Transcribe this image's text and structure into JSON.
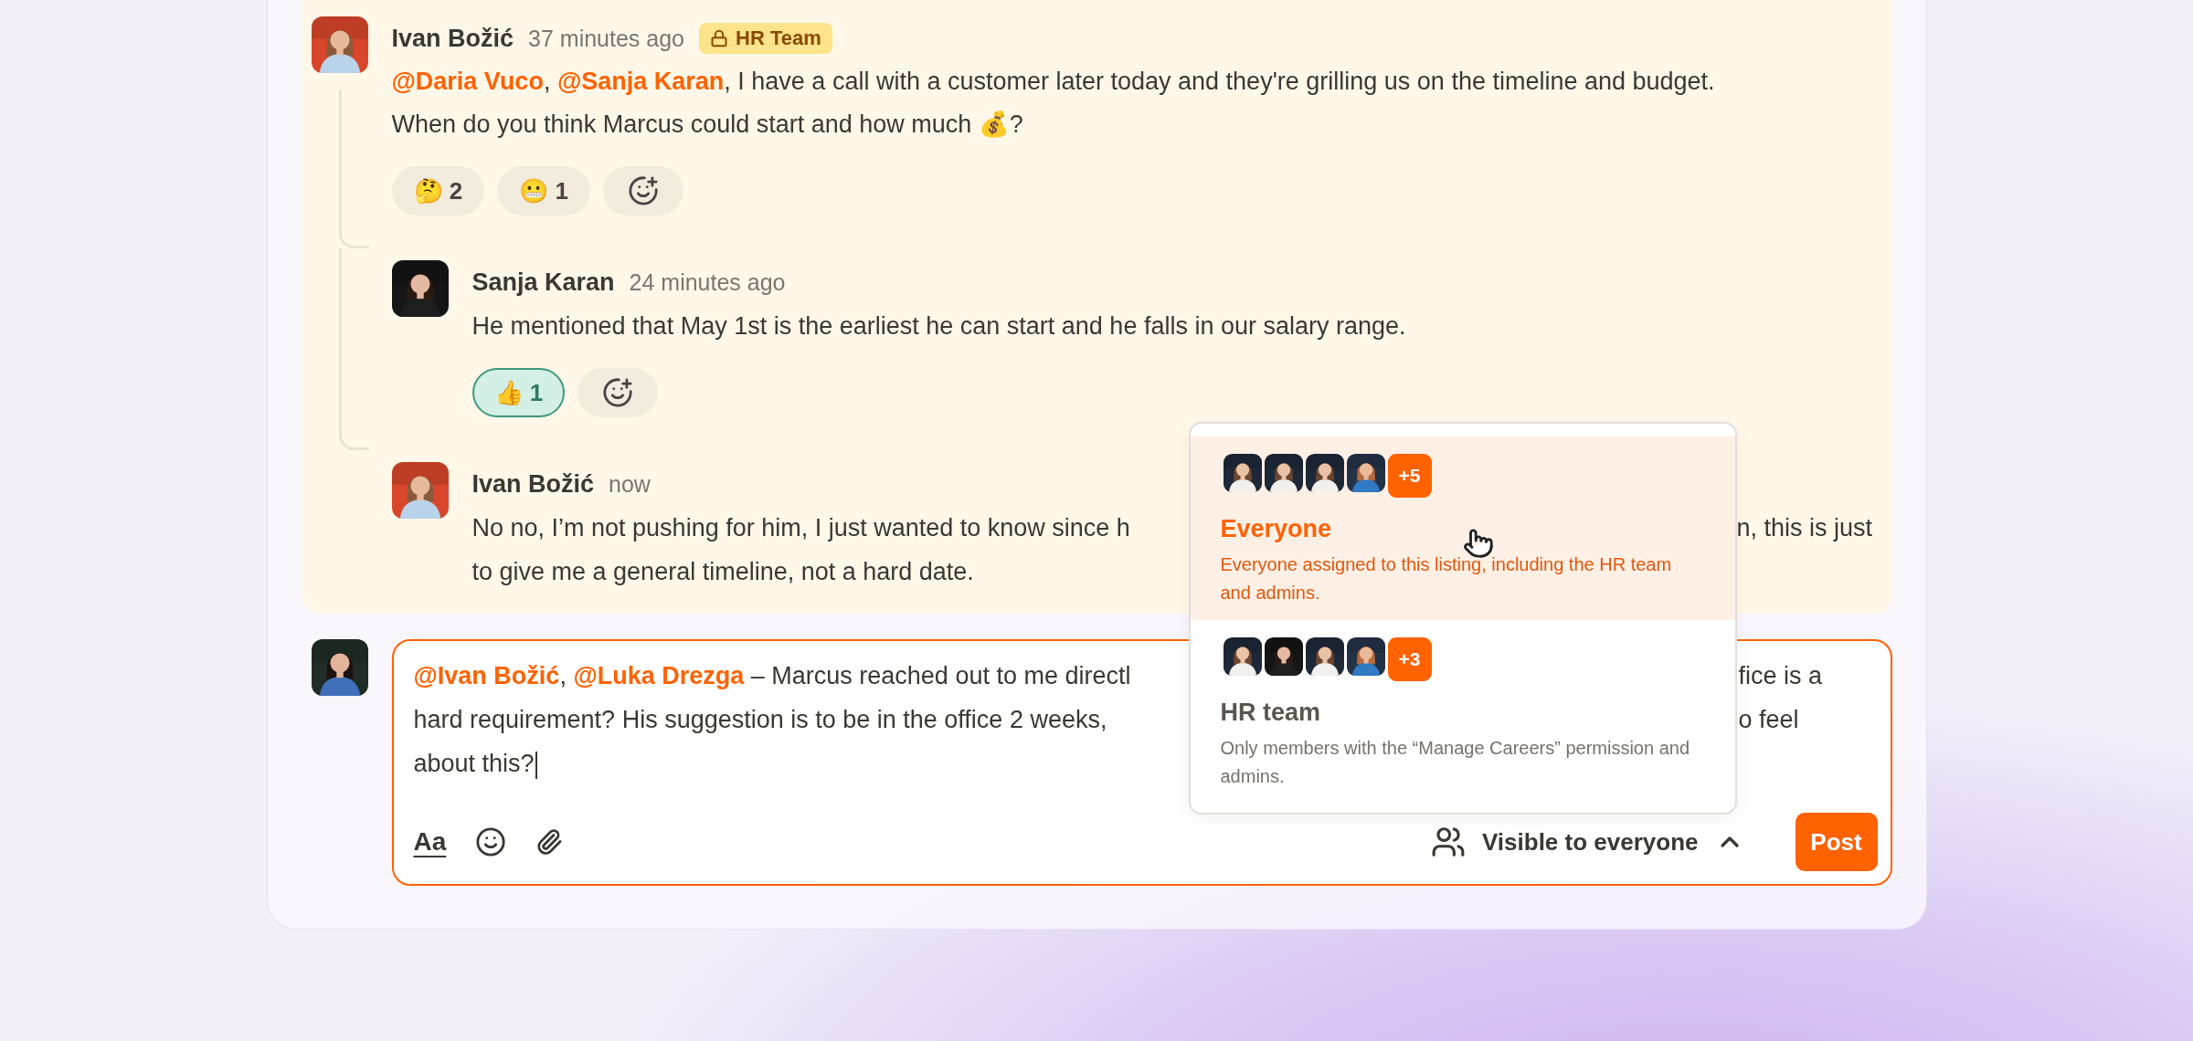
{
  "thread": {
    "root": {
      "author": "Ivan Božić",
      "time": "37 minutes ago",
      "badge": {
        "label": "HR Team"
      },
      "text": "**@Daria Vuco**, **@Sanja Karan**, I have a call with a customer later today and they're grilling us on the timeline and budget. When do you think Marcus could start and how much 💰?",
      "reactions": [
        {
          "emoji": "🤔",
          "count": "2",
          "selected": false
        },
        {
          "emoji": "😬",
          "count": "1",
          "selected": false
        }
      ]
    },
    "replies": [
      {
        "author": "Sanja Karan",
        "time": "24 minutes ago",
        "lines": [
          {
            "left": "He mentioned that May 1st is the earliest he can start and he falls in our salary range."
          }
        ],
        "reactions": [
          {
            "emoji": "👍",
            "count": "1",
            "selected": true
          }
        ]
      },
      {
        "author": "Ivan Božić",
        "time": "now",
        "lines": [
          {
            "left": "No no, I’m not pushing for him, I just wanted to know since h",
            "right": "n, this is just"
          },
          {
            "left": "to give me a general timeline, not a hard date."
          }
        ]
      }
    ]
  },
  "composer": {
    "lines": [
      {
        "left": "**@Ivan Božić**, **@Luka Drezga** – Marcus reached out to me directl",
        "right": "fice is a"
      },
      {
        "left": "hard requirement? His suggestion is to be in the office 2 weeks,",
        "right": "o feel"
      },
      {
        "left": "about this?"
      }
    ],
    "format_button": "Aa",
    "visibility": "Visible to everyone",
    "post_button": "Post"
  },
  "visibility_menu": {
    "options": [
      {
        "title": "Everyone",
        "description": "Everyone assigned to this listing, including the HR team and admins.",
        "more": "+5",
        "selected": true
      },
      {
        "title": "HR team",
        "description": "Only members with the “Manage Careers” permission and admins.",
        "more": "+3",
        "selected": false
      }
    ]
  }
}
